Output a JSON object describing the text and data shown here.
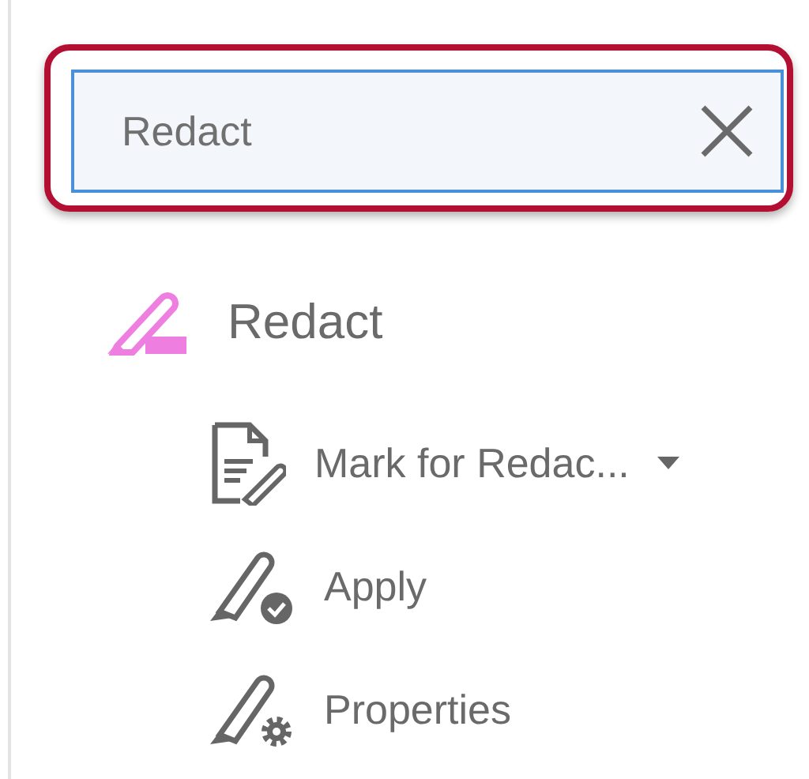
{
  "search": {
    "value": "Redact",
    "highlighted": true
  },
  "tool": {
    "name": "Redact"
  },
  "actions": [
    {
      "kind": "mark",
      "label": "Mark for Redac...",
      "has_menu": true
    },
    {
      "kind": "apply",
      "label": "Apply",
      "has_menu": false
    },
    {
      "kind": "properties",
      "label": "Properties",
      "has_menu": false
    }
  ]
}
